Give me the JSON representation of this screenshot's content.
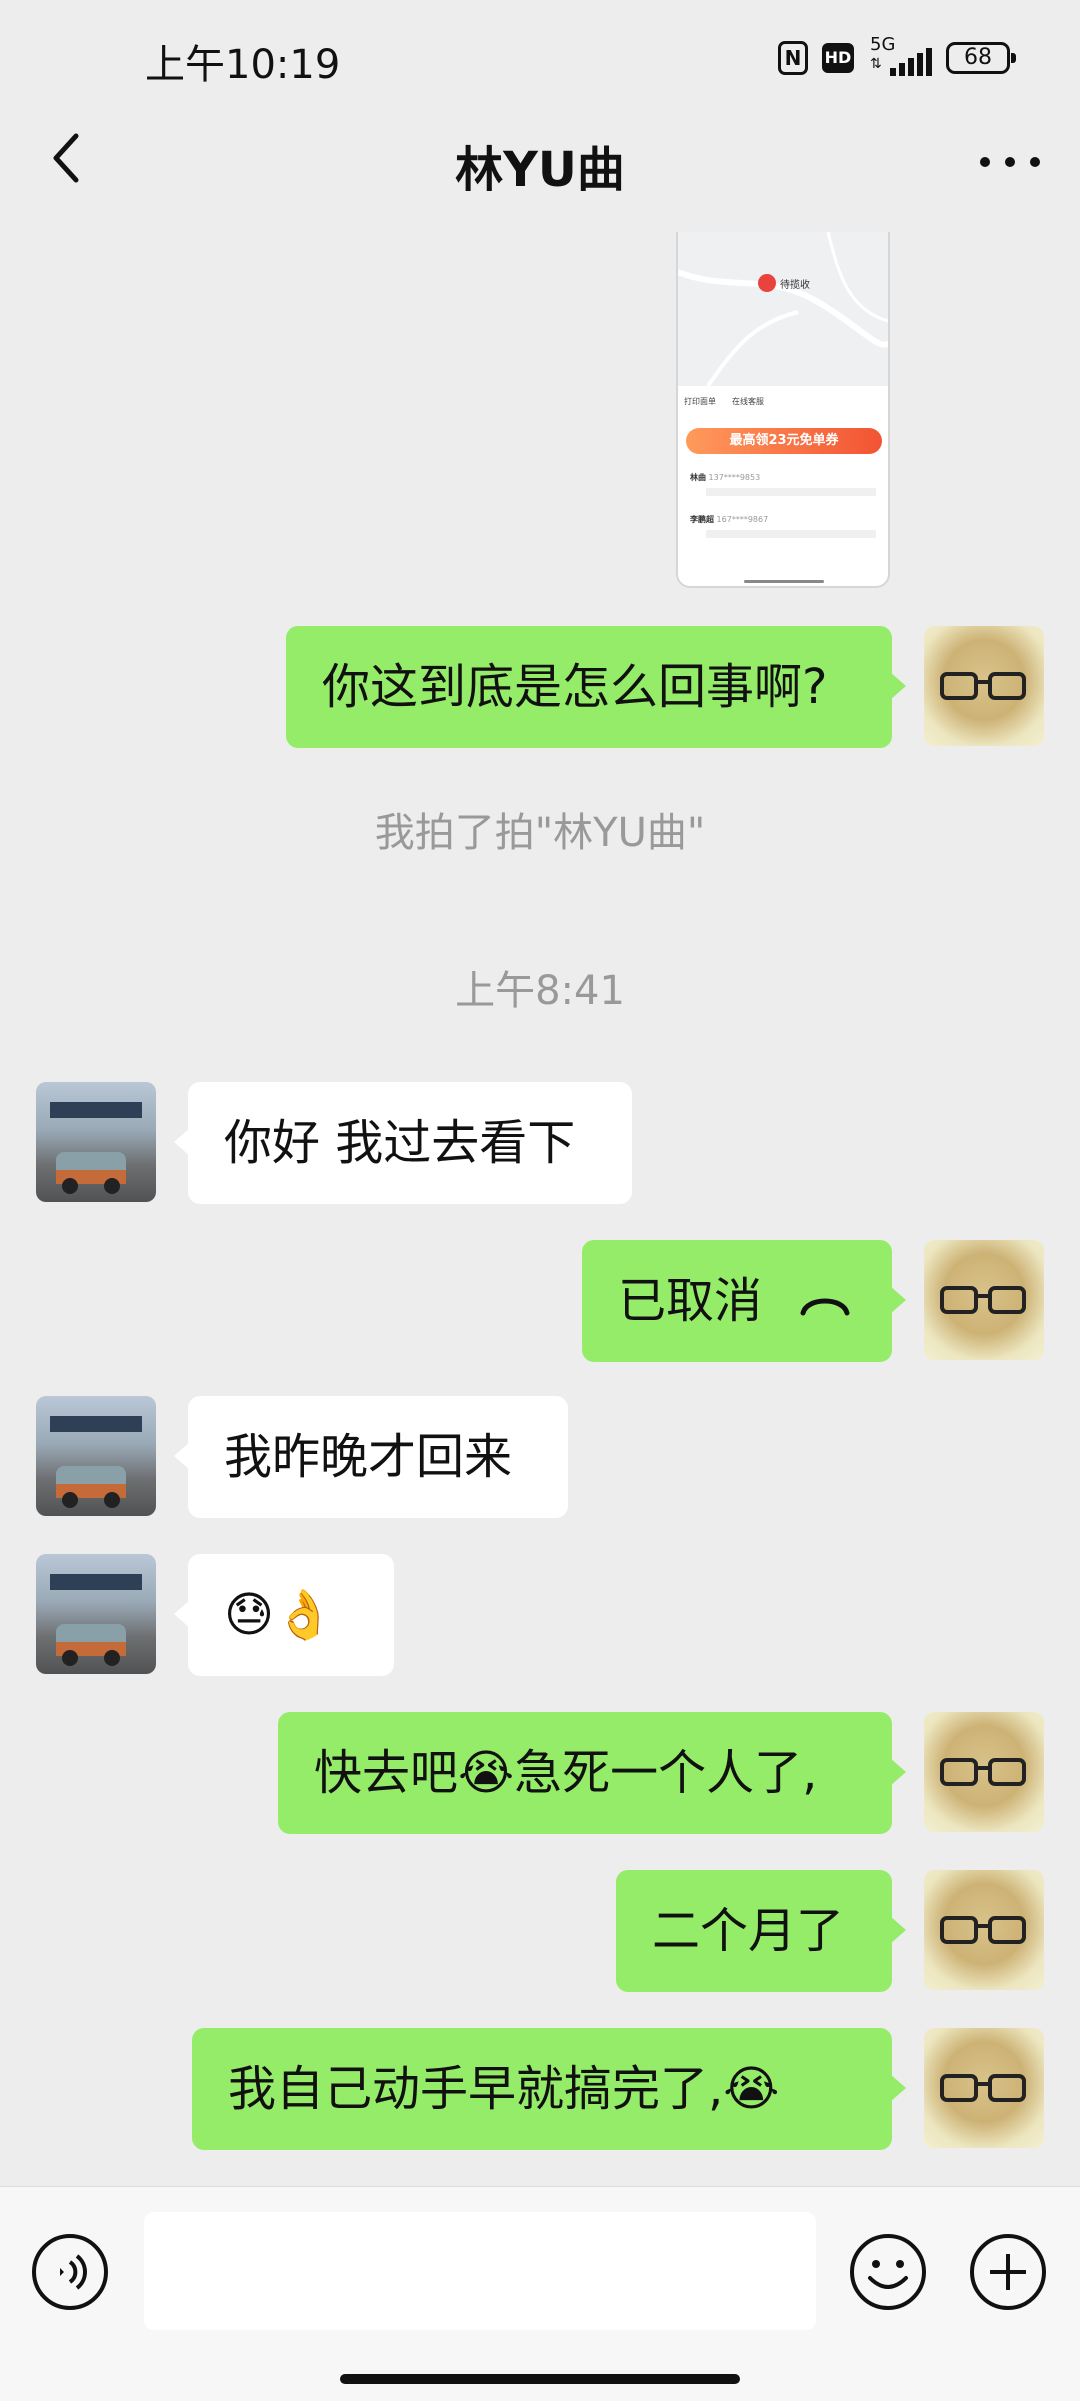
{
  "status_bar": {
    "time": "上午10:19",
    "nfc": "N",
    "hd": "HD",
    "network": "5G",
    "battery": "68"
  },
  "header": {
    "title": "林YU曲"
  },
  "shared_screenshot": {
    "status": "待揽收",
    "tool_1": "打印面单",
    "tool_2": "在线客服",
    "banner": "最高领23元免单券",
    "sender_name": "林曲",
    "sender_phone": "137****9853",
    "receiver_name": "李鹏超",
    "receiver_phone": "167****9867"
  },
  "messages": [
    {
      "side": "me",
      "text": "你这到底是怎么回事啊?"
    },
    {
      "side": "system",
      "text": "我拍了拍\"林YU曲\""
    },
    {
      "side": "time",
      "text": "上午8:41"
    },
    {
      "side": "other",
      "text": "你好 我过去看下"
    },
    {
      "side": "me",
      "text": "已取消",
      "icon": "hangup-icon"
    },
    {
      "side": "other",
      "text": "我昨晚才回来"
    },
    {
      "side": "other",
      "text": "😓👌"
    },
    {
      "side": "me",
      "text": "快去吧😭急死一个人了,"
    },
    {
      "side": "me",
      "text": "二个月了"
    },
    {
      "side": "me",
      "text": "我自己动手早就搞完了,😭"
    }
  ],
  "input": {
    "value": "",
    "placeholder": ""
  },
  "colors": {
    "my_bubble": "#95ec69",
    "their_bubble": "#ffffff",
    "background": "#ededed"
  }
}
